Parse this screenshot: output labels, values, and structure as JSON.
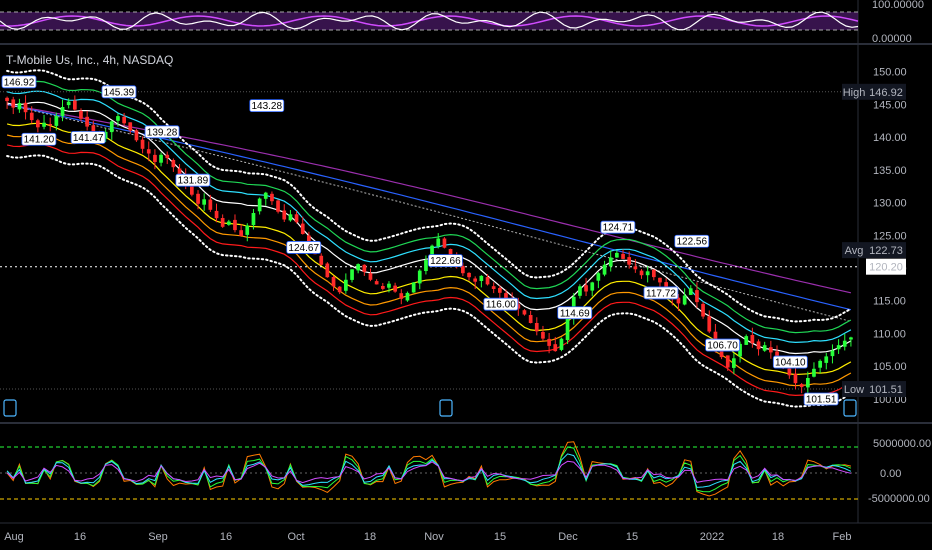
{
  "chart_data": {
    "type": "candlestick",
    "title": "T-Mobile Us, Inc., 4h, NASDAQ",
    "colors": {
      "up": "#26ff3a",
      "down": "#ff2a2a",
      "background": "#000000"
    },
    "x_ticks": [
      "Aug",
      "16",
      "Sep",
      "16",
      "Oct",
      "18",
      "Nov",
      "15",
      "Dec",
      "15",
      "2022",
      "18",
      "Feb"
    ],
    "price_axis": {
      "ticks": [
        "150.00",
        "145.00",
        "140.00",
        "135.00",
        "130.00",
        "125.00",
        "120.00",
        "115.00",
        "110.00",
        "105.00",
        "100.00"
      ],
      "ylim": [
        98,
        153
      ]
    },
    "price_markers": {
      "high": {
        "label": "High",
        "value": "146.92"
      },
      "avg": {
        "label": "Avg",
        "value": "122.73"
      },
      "last": {
        "value": "120.20"
      },
      "low": {
        "label": "Low",
        "value": "101.51"
      }
    },
    "swing_labels": [
      "146.92",
      "141.20",
      "141.47",
      "145.39",
      "139.28",
      "143.28",
      "131.89",
      "124.67",
      "122.66",
      "116.00",
      "124.71",
      "114.69",
      "117.72",
      "106.70",
      "122.56",
      "104.10",
      "101.51"
    ],
    "top_panel": {
      "ticks": [
        "100.00000",
        "0.00000"
      ]
    },
    "bottom_panel": {
      "ticks": [
        "5000000.00",
        "0.00",
        "-5000000.00"
      ]
    },
    "series_close": [
      145.5,
      144.5,
      145.2,
      143.8,
      142.6,
      141.5,
      142.2,
      141.8,
      143.2,
      144.6,
      145.4,
      144.2,
      142.8,
      141.6,
      140.2,
      139.5,
      140.8,
      142.4,
      143.2,
      142.1,
      141.0,
      139.5,
      138.2,
      137.5,
      136.2,
      137.3,
      136.8,
      135.4,
      134.1,
      132.6,
      131.2,
      129.8,
      130.5,
      128.9,
      127.6,
      126.3,
      127.1,
      125.8,
      124.9,
      126.5,
      128.4,
      130.6,
      131.5,
      130.2,
      128.6,
      127.4,
      128.2,
      127.0,
      125.2,
      123.6,
      122.1,
      120.5,
      118.6,
      117.2,
      116.3,
      118.2,
      119.8,
      120.6,
      119.4,
      118.2,
      117.5,
      116.8,
      117.6,
      116.4,
      115.3,
      116.2,
      117.8,
      119.6,
      121.2,
      123.4,
      124.5,
      123.1,
      121.8,
      120.5,
      119.2,
      118.6,
      117.9,
      118.8,
      117.5,
      116.8,
      116.2,
      115.4,
      114.6,
      113.8,
      112.9,
      111.6,
      110.3,
      109.2,
      108.1,
      107.3,
      109.2,
      112.4,
      115.6,
      117.2,
      116.4,
      117.8,
      119.2,
      120.5,
      121.6,
      122.3,
      121.4,
      120.5,
      119.8,
      118.9,
      119.5,
      118.6,
      117.8,
      116.4,
      115.2,
      114.6,
      115.8,
      116.9,
      114.8,
      112.6,
      110.3,
      108.2,
      106.4,
      104.8,
      106.2,
      108.4,
      109.6,
      108.5,
      107.6,
      108.2,
      107.1,
      106.3,
      104.8,
      103.6,
      102.4,
      101.8,
      103.2,
      104.6,
      105.8,
      106.5,
      107.4,
      108.2,
      108.9,
      109.4
    ]
  }
}
